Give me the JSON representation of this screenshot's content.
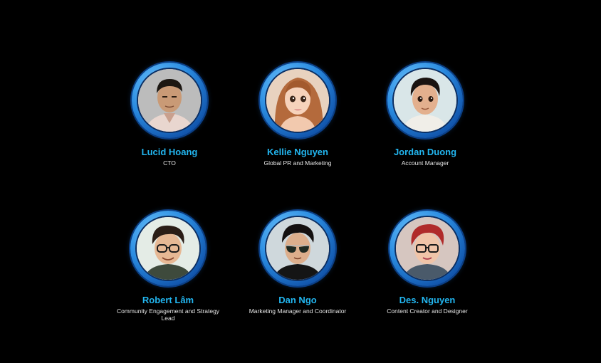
{
  "team": {
    "members": [
      {
        "name": "Lucid Hoang",
        "role": "CTO",
        "avatar": "man-photo-avatar"
      },
      {
        "name": "Kellie Nguyen",
        "role": "Global PR and Marketing",
        "avatar": "woman-cartoon-avatar"
      },
      {
        "name": "Jordan Duong",
        "role": "Account Manager",
        "avatar": "man-cartoon-avatar"
      },
      {
        "name": "Robert Lâm",
        "role": "Community Engagement and Strategy Lead",
        "avatar": "man-glasses-cartoon-avatar"
      },
      {
        "name": "Dan Ngo",
        "role": "Marketing Manager and Coordinator",
        "avatar": "man-sunglasses-cartoon-avatar"
      },
      {
        "name": "Des. Nguyen",
        "role": "Content Creator and Designer",
        "avatar": "redhair-glasses-cartoon-avatar"
      }
    ]
  },
  "colors": {
    "background": "#000000",
    "name_text": "#22b6f0",
    "role_text": "#e6e6e6",
    "ring_accent": "#2a8be0"
  }
}
